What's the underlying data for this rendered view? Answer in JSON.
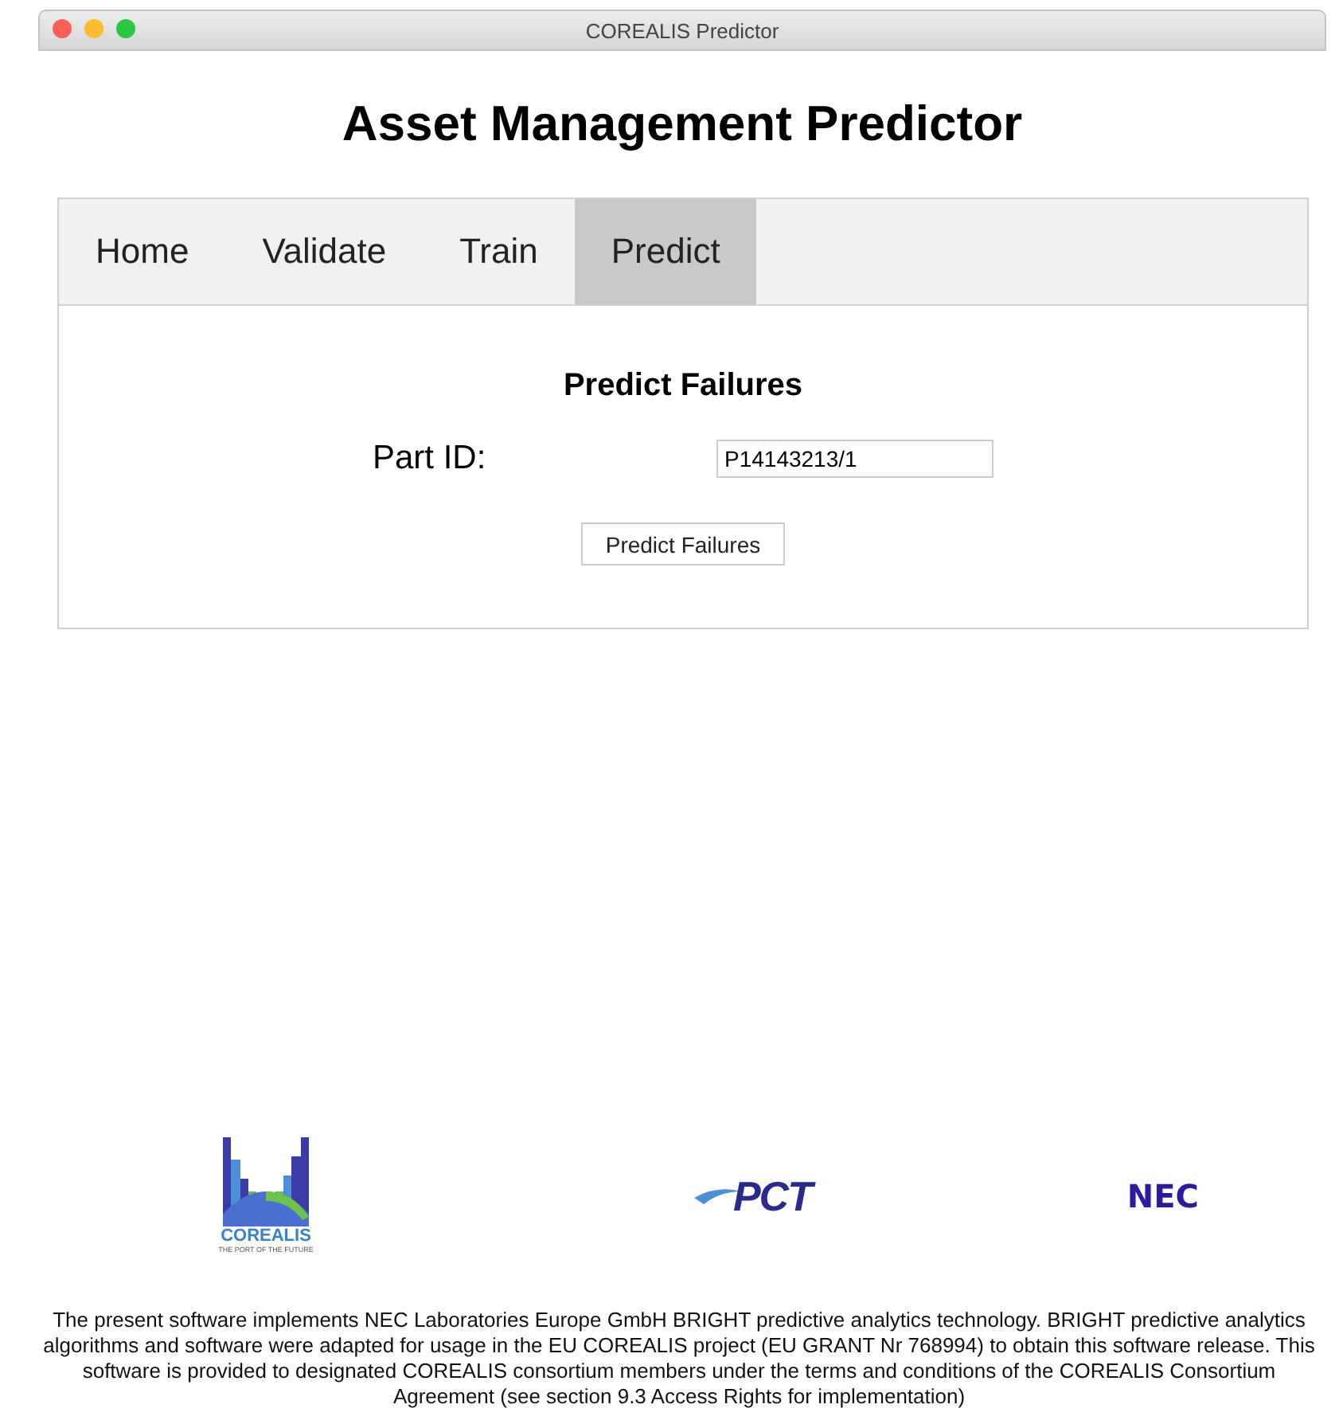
{
  "window": {
    "title": "COREALIS Predictor"
  },
  "heading": "Asset Management Predictor",
  "tabs": [
    {
      "label": "Home",
      "selected": false
    },
    {
      "label": "Validate",
      "selected": false
    },
    {
      "label": "Train",
      "selected": false
    },
    {
      "label": "Predict",
      "selected": true
    }
  ],
  "panel": {
    "title": "Predict Failures",
    "field_label": "Part ID:",
    "field_value": "P14143213/1",
    "button": "Predict Failures"
  },
  "logos": [
    {
      "kind": "corealis",
      "name": "COREALIS",
      "tagline": "THE PORT OF THE FUTURE"
    },
    {
      "kind": "pct",
      "name": "PCT"
    },
    {
      "kind": "nec",
      "name": "NEC"
    }
  ],
  "footer": "The present software implements NEC Laboratories Europe GmbH BRIGHT predictive analytics technology. BRIGHT predictive analytics algorithms and software were adapted for usage in the EU COREALIS project (EU GRANT Nr 768994) to obtain this software release. This software is provided to designated COREALIS consortium members under the terms and conditions of the COREALIS Consortium Agreement (see section 9.3 Access Rights for implementation)"
}
